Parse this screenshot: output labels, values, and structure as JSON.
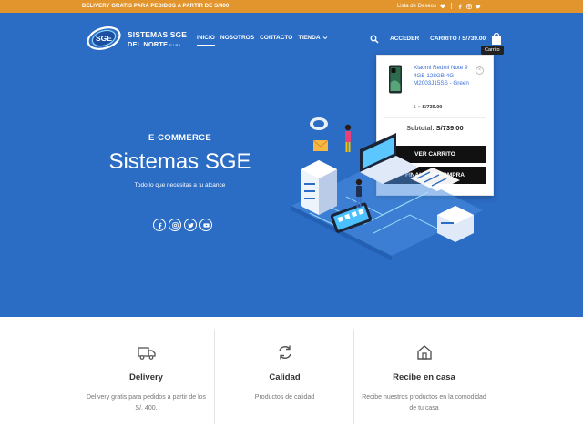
{
  "topbar": {
    "promo": "DELIVERY GRATIS PARA PEDIDOS A PARTIR DE S/400",
    "wishlist": "Lista de Deseos"
  },
  "logo": {
    "line1": "SISTEMAS SGE",
    "line2": "DEL NORTE",
    "suffix": "E.I.R.L.",
    "emblem": "SGE"
  },
  "nav": {
    "items": [
      "INICIO",
      "NOSOTROS",
      "CONTACTO",
      "TIENDA"
    ],
    "active": "INICIO"
  },
  "header": {
    "login": "ACCEDER",
    "cart_label": "CARRITO / S/739.00",
    "tooltip": "Carrito"
  },
  "cart": {
    "product_name": "Xiaomi Redmi Note 9 4GB 128GB 4G M2003J15SS - Green",
    "qty_text": "1 × S/739.00",
    "qty": "1",
    "price": "S/739.00",
    "subtotal_label": "Subtotal:",
    "subtotal_value": "S/739.00",
    "view_cart": "VER CARRITO",
    "checkout": "FINALIZAR COMPRA"
  },
  "hero": {
    "kicker": "E-COMMERCE",
    "title": "Sistemas SGE",
    "subtitle": "Todo lo que necesitas a tu alcance"
  },
  "socials": [
    "facebook-icon",
    "instagram-icon",
    "twitter-icon",
    "youtube-icon"
  ],
  "features": [
    {
      "title": "Delivery",
      "desc": "Delivery gratis para pedidos a partir de los S/. 400.",
      "icon": "truck-icon"
    },
    {
      "title": "Calidad",
      "desc": "Productos de calidad",
      "icon": "refresh-icon"
    },
    {
      "title": "Recibe en casa",
      "desc": "Recibe nuestros productos en la comodidad de tu casa",
      "icon": "home-icon"
    }
  ],
  "colors": {
    "topbar": "#e2952d",
    "hero": "#2b6cc4",
    "button": "#111111",
    "link": "#3b6fd6"
  }
}
